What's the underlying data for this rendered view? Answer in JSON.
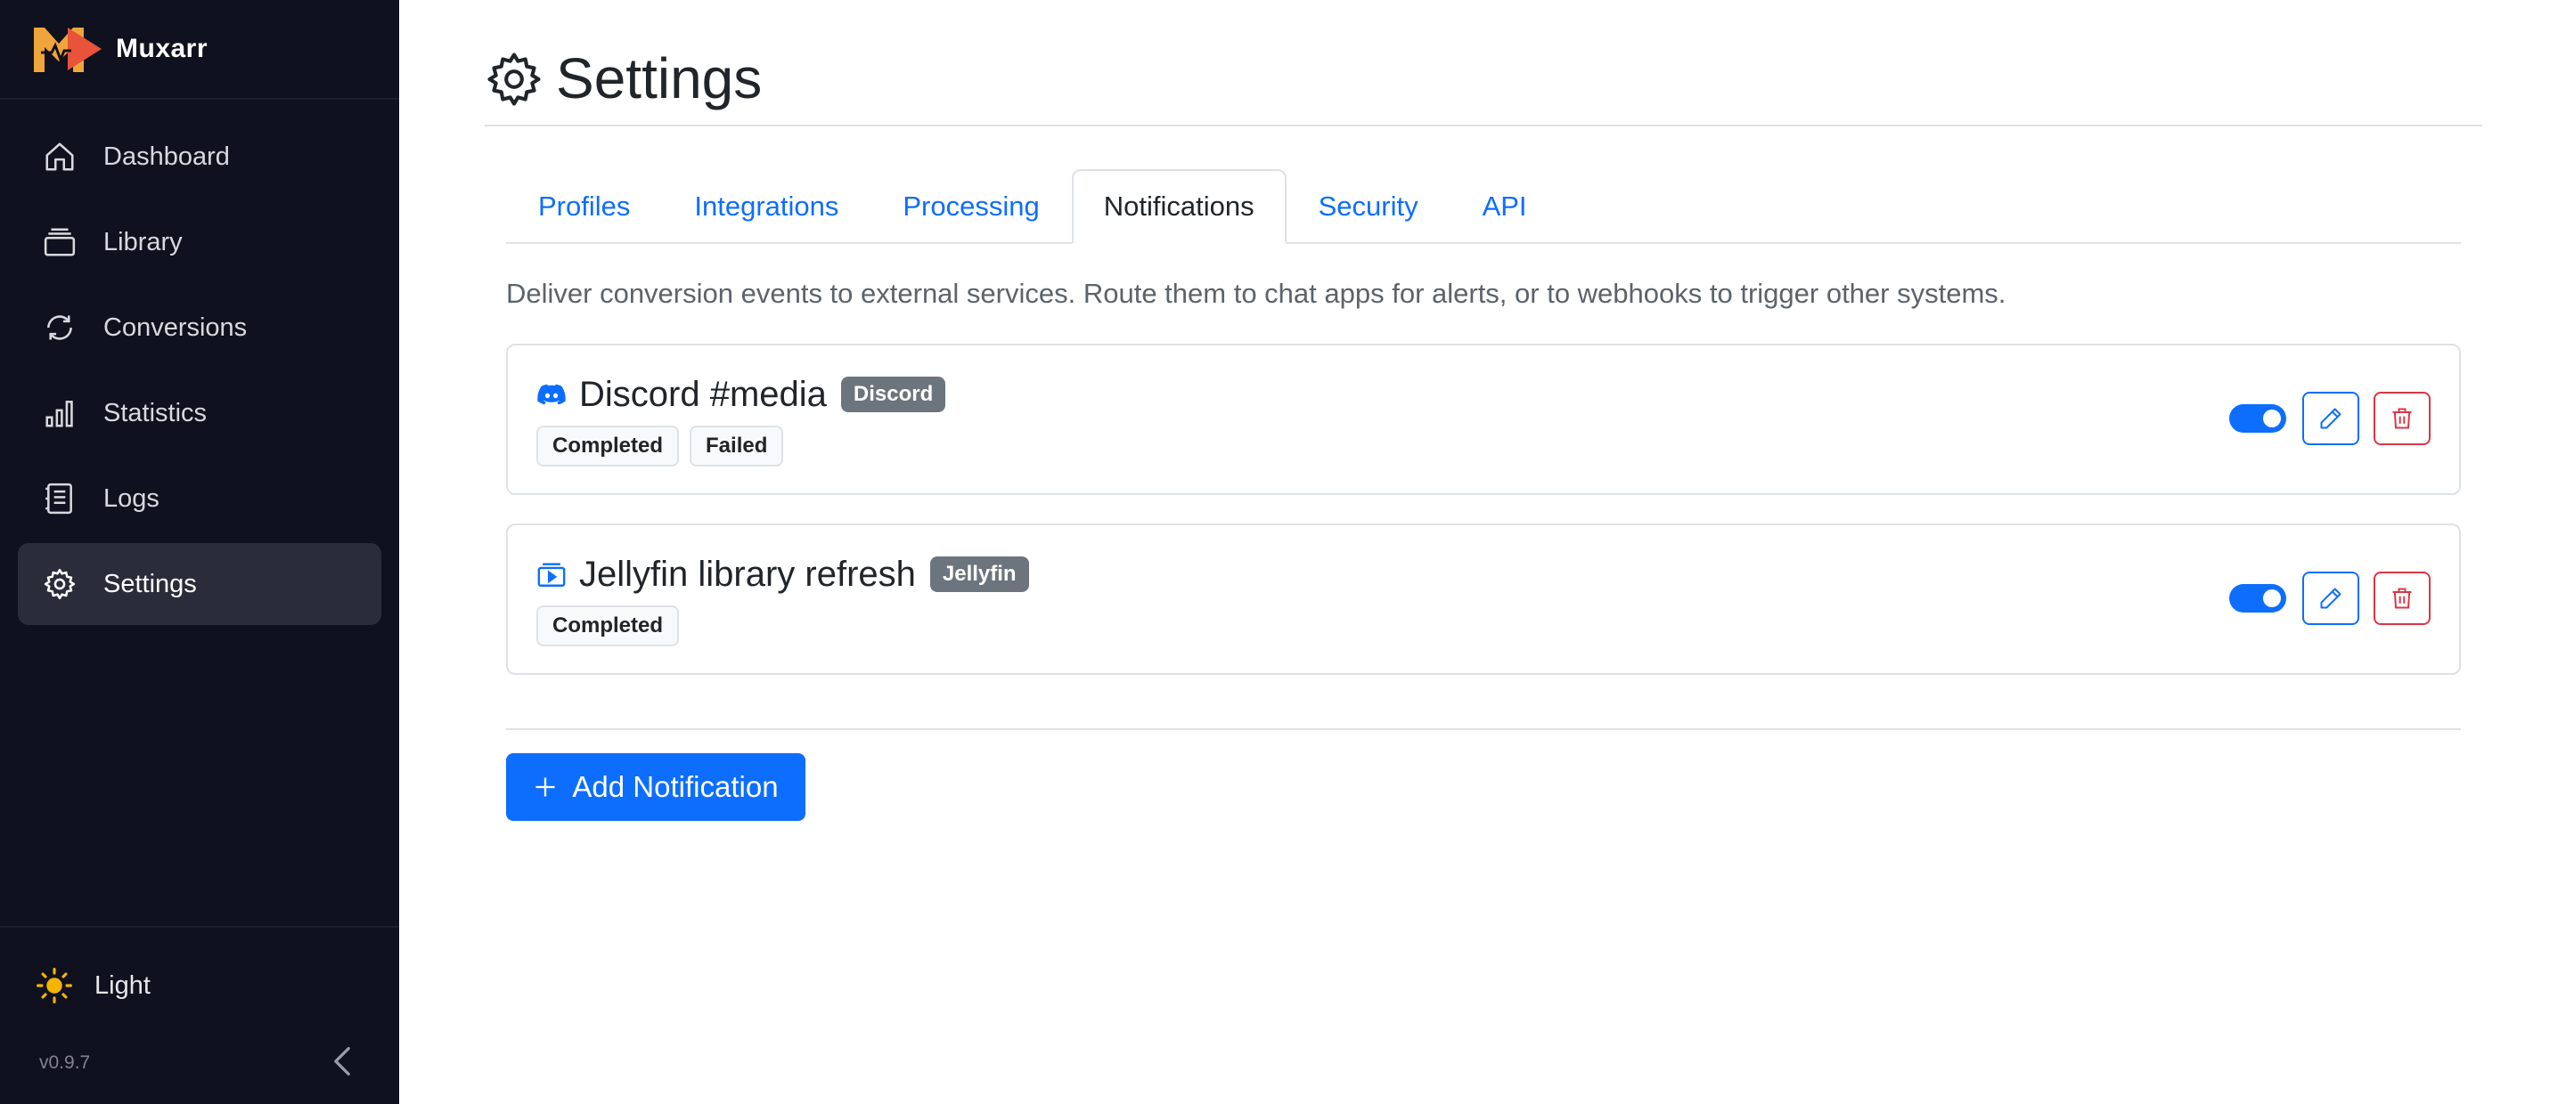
{
  "app": {
    "name": "Muxarr",
    "version": "v0.9.7"
  },
  "sidebar": {
    "items": [
      {
        "label": "Dashboard",
        "icon": "home-icon"
      },
      {
        "label": "Library",
        "icon": "library-icon"
      },
      {
        "label": "Conversions",
        "icon": "refresh-icon"
      },
      {
        "label": "Statistics",
        "icon": "bar-chart-icon"
      },
      {
        "label": "Logs",
        "icon": "log-icon"
      },
      {
        "label": "Settings",
        "icon": "gear-icon",
        "active": true
      }
    ],
    "theme_label": "Light"
  },
  "page": {
    "title": "Settings"
  },
  "tabs": [
    {
      "label": "Profiles"
    },
    {
      "label": "Integrations"
    },
    {
      "label": "Processing"
    },
    {
      "label": "Notifications",
      "active": true
    },
    {
      "label": "Security"
    },
    {
      "label": "API"
    }
  ],
  "notifications": {
    "description": "Deliver conversion events to external services. Route them to chat apps for alerts, or to webhooks to trigger other systems.",
    "items": [
      {
        "name": "Discord #media",
        "type": "Discord",
        "icon": "discord-icon",
        "events": [
          "Completed",
          "Failed"
        ],
        "enabled": true
      },
      {
        "name": "Jellyfin library refresh",
        "type": "Jellyfin",
        "icon": "jellyfin-icon",
        "events": [
          "Completed"
        ],
        "enabled": true
      }
    ],
    "add_label": "Add Notification"
  },
  "colors": {
    "sidebar_bg": "#10111e",
    "accent": "#0d6efd",
    "danger": "#dc3545",
    "badge_bg": "#6c757d",
    "sun": "#f5b400"
  }
}
